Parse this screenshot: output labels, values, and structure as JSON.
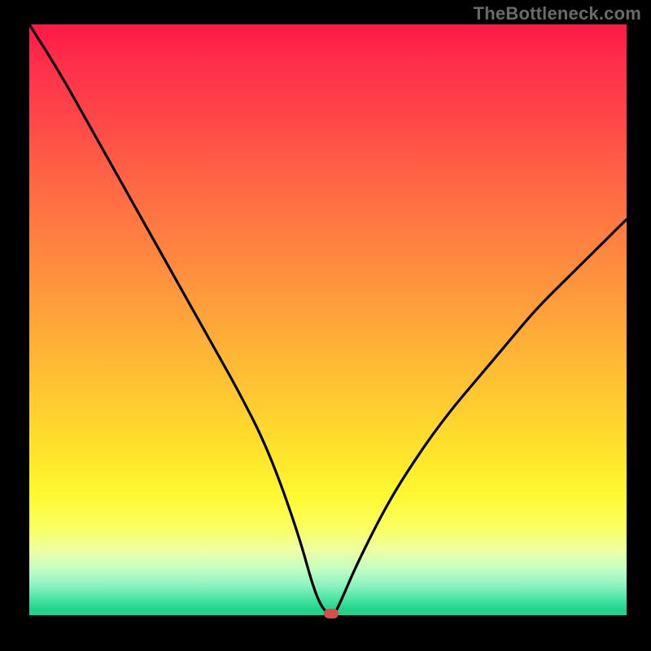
{
  "watermark": "TheBottleneck.com",
  "colors": {
    "frame": "#000000",
    "marker": "#d35051",
    "curve": "#000000",
    "gradient_top": "#ff1846",
    "gradient_bottom": "#22d38a"
  },
  "chart_data": {
    "type": "line",
    "title": "",
    "xlabel": "",
    "ylabel": "",
    "xlim": [
      0,
      100
    ],
    "ylim": [
      0,
      100
    ],
    "grid": false,
    "legend": false,
    "annotations": [],
    "series": [
      {
        "name": "bottleneck-curve",
        "x": [
          0,
          5,
          10,
          15,
          20,
          25,
          30,
          35,
          40,
          45,
          48,
          50,
          51,
          52,
          55,
          60,
          65,
          70,
          75,
          80,
          85,
          90,
          95,
          100
        ],
        "values": [
          100,
          92,
          83,
          74,
          65,
          56,
          47,
          38,
          28,
          14,
          3,
          0,
          0,
          2,
          9,
          19,
          27,
          34,
          40,
          46,
          52,
          57,
          62,
          67
        ]
      }
    ],
    "minimum_marker": {
      "x": 50.5,
      "y": 0
    },
    "flat_bottom_x_range": [
      48.5,
      51.5
    ]
  }
}
